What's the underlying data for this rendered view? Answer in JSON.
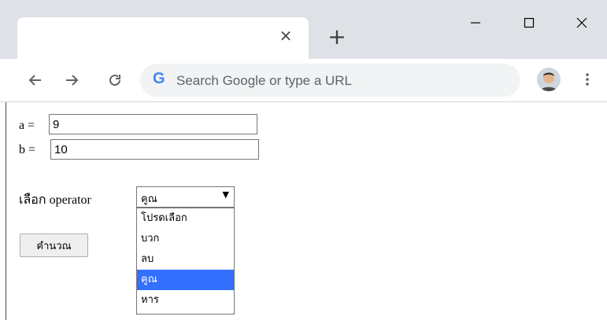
{
  "browser": {
    "tab": {
      "title": "",
      "close_glyph": "×"
    },
    "new_tab_glyph": "+",
    "omnibox": {
      "placeholder": "Search Google or type a URL",
      "logo": "G"
    }
  },
  "form": {
    "a_label": "a =",
    "a_value": "9",
    "b_label": "b =",
    "b_value": "10",
    "operator_label": "เลือก operator",
    "operator_selected": "คูณ",
    "operator_arrow": "▼",
    "operator_options": [
      "โปรดเลือก",
      "บวก",
      "ลบ",
      "คูณ",
      "หาร"
    ],
    "selected_index": 3,
    "calculate_label": "คำนวณ"
  },
  "colors": {
    "chrome_bg": "#dee1e6",
    "omnibox_bg": "#f1f3f4",
    "selection": "#3370ff"
  }
}
